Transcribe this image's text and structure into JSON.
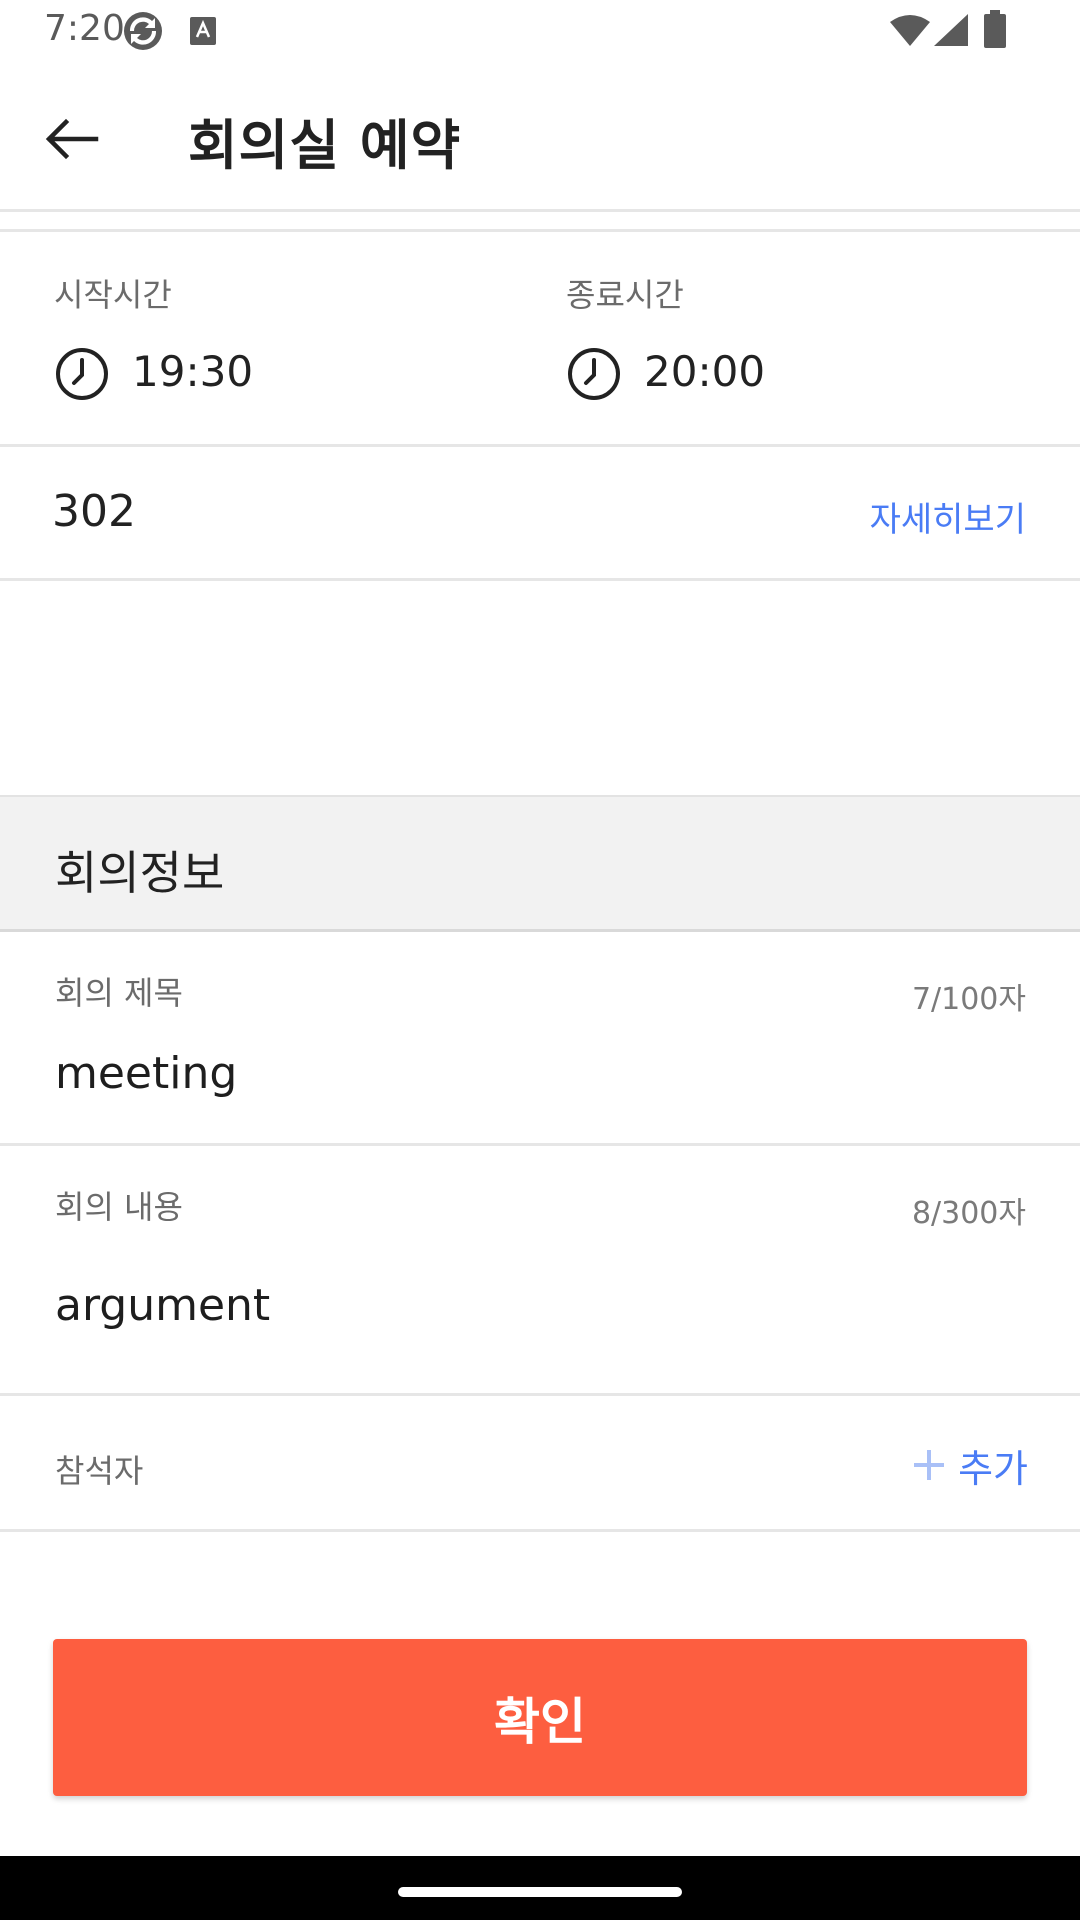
{
  "status_bar": {
    "time": "7:20",
    "icons": [
      "sync-icon",
      "keyboard-a-icon",
      "wifi-icon",
      "signal-icon",
      "battery-icon"
    ]
  },
  "app_bar": {
    "back_icon": "arrow-left-icon",
    "title": "회의실 예약"
  },
  "time_section": {
    "start_label": "시작시간",
    "start_value": "19:30",
    "end_label": "종료시간",
    "end_value": "20:00",
    "icon": "clock-icon"
  },
  "room": {
    "number": "302",
    "detail_link": "자세히보기"
  },
  "meeting_info": {
    "section_title": "회의정보",
    "title_field": {
      "label": "회의 제목",
      "count": "7/100자",
      "value": "meeting"
    },
    "content_field": {
      "label": "회의 내용",
      "count": "8/300자",
      "value": "argument"
    },
    "attendees": {
      "label": "참석자",
      "add_label": "추가"
    }
  },
  "confirm_button": {
    "label": "확인"
  },
  "colors": {
    "accent_blue": "#4a7cf5",
    "confirm_orange": "#fd5e40",
    "section_bg": "#f2f2f2"
  }
}
